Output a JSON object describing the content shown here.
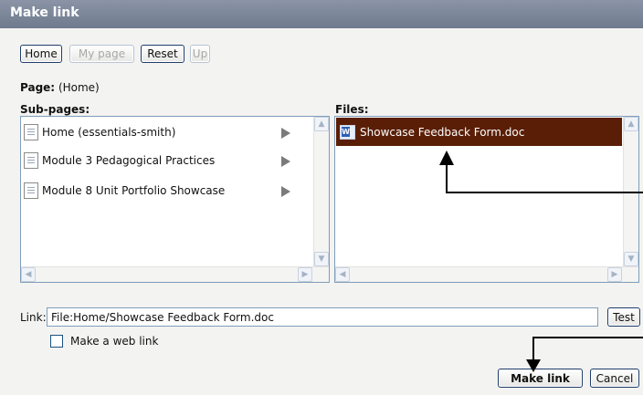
{
  "dialog": {
    "title": "Make link"
  },
  "nav": {
    "home": "Home",
    "my_page": "My page",
    "reset": "Reset",
    "up": "Up"
  },
  "page": {
    "label": "Page:",
    "value": "(Home)"
  },
  "subpages": {
    "title": "Sub-pages:",
    "items": [
      {
        "label": "Home (essentials-smith)",
        "icon": "document-icon",
        "expand_icon": "expand-arrow-icon"
      },
      {
        "label": "Module 3 Pedagogical Practices",
        "icon": "document-icon",
        "expand_icon": "expand-arrow-icon"
      },
      {
        "label": "Module 8 Unit Portfolio Showcase",
        "icon": "document-icon",
        "expand_icon": "expand-arrow-icon"
      }
    ]
  },
  "files": {
    "title": "Files:",
    "items": [
      {
        "label": "Showcase Feedback Form.doc",
        "icon": "word-document-icon",
        "selected": true
      }
    ],
    "selected_color": "#5a1e06"
  },
  "link": {
    "label": "Link:",
    "value": "File:Home/Showcase Feedback Form.doc",
    "test": "Test"
  },
  "web_link": {
    "label": "Make a web link",
    "checked": false
  },
  "actions": {
    "make_link": "Make link",
    "cancel": "Cancel"
  },
  "colors": {
    "titlebar": "#7a8599",
    "button_border": "#1f3d6b",
    "panel_border": "#7f9db9"
  }
}
